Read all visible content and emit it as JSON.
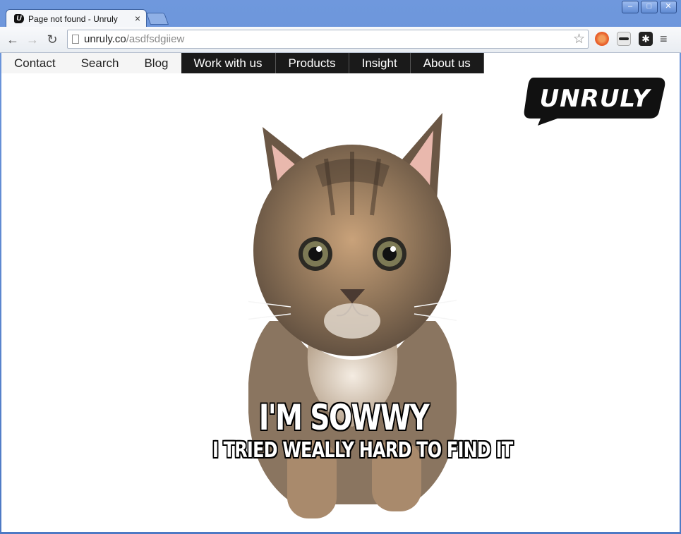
{
  "browser": {
    "tab_title": "Page not found - Unruly",
    "tab_favicon_letter": "U",
    "close_glyph": "×",
    "url_host": "unruly.co",
    "url_path": "/asdfsdgiiew",
    "window_controls": {
      "minimize": "–",
      "maximize": "□",
      "close": "✕"
    },
    "icons": {
      "back": "back-arrow-icon",
      "forward": "forward-arrow-icon",
      "reload": "reload-icon",
      "star": "star-icon",
      "menu": "menu-icon"
    },
    "glyphs": {
      "back": "←",
      "forward": "→",
      "reload": "↻",
      "star": "☆",
      "menu": "≡",
      "ext3": "✱"
    }
  },
  "site": {
    "nav": [
      {
        "label": "Contact"
      },
      {
        "label": "Search"
      },
      {
        "label": "Blog"
      },
      {
        "label": "Work with us"
      },
      {
        "label": "Products"
      },
      {
        "label": "Insight"
      },
      {
        "label": "About us"
      }
    ],
    "logo_text": "UNRULY",
    "caption_main": "I'M SOWWY",
    "caption_sub": "I TRIED WEALLY HARD TO FIND IT"
  },
  "colors": {
    "nav_dark": "#1a1a1a",
    "logo_bg": "#111111",
    "chrome_blue": "#5b86cf"
  }
}
